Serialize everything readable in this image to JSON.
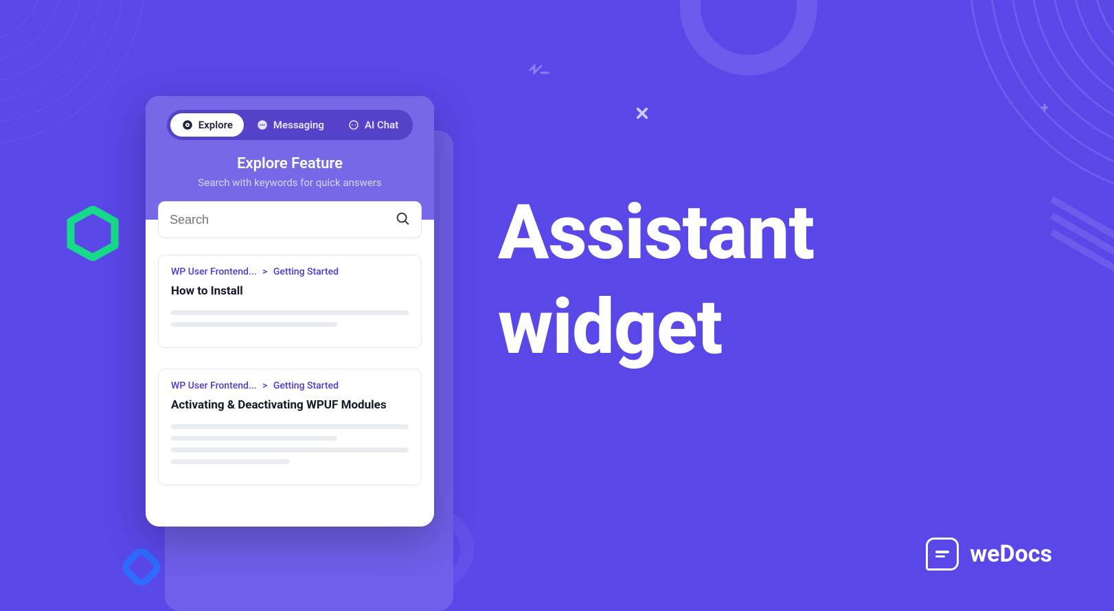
{
  "hero": {
    "line1": "Assistant",
    "line2": "widget"
  },
  "brand": {
    "name": "weDocs"
  },
  "widget": {
    "tabs": {
      "explore": {
        "label": "Explore"
      },
      "messaging": {
        "label": "Messaging"
      },
      "aichat": {
        "label": "AI Chat"
      }
    },
    "title": "Explore Feature",
    "subtitle": "Search with keywords for quick answers",
    "search_placeholder": "Search",
    "results": [
      {
        "crumb_a": "WP User Frontend...",
        "crumb_b": "Getting Started",
        "title": "How to Install"
      },
      {
        "crumb_a": "WP User Frontend...",
        "crumb_b": "Getting Started",
        "title": "Activating & Deactivating WPUF Modules"
      }
    ]
  }
}
